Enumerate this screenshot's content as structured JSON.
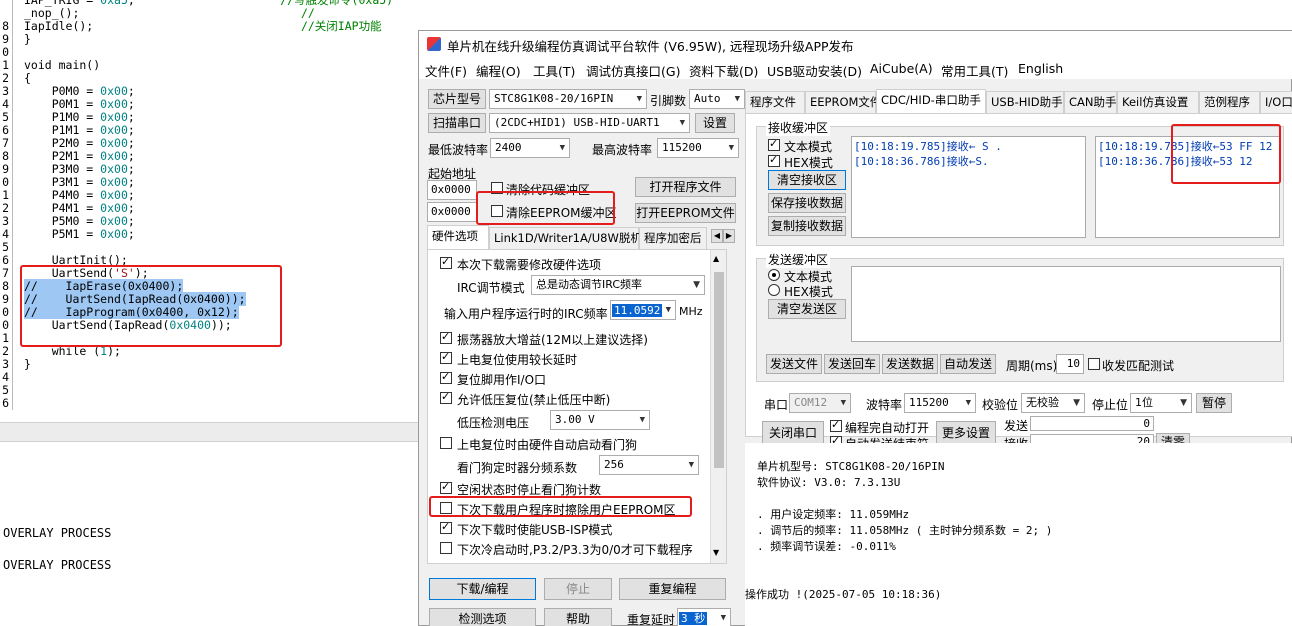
{
  "editor": {
    "lines": [
      {
        "n": "",
        "html": "IAP_TRIG = <span class='num'>0xa5</span>;                     <span class='cmt'>//写触发命令(0xa5)</span>"
      },
      {
        "n": "",
        "html": "_nop_();                                <span class='cmt'>//</span>"
      },
      {
        "n": "8",
        "html": "IapIdle();                              <span class='cmt'>//关闭IAP功能</span>"
      },
      {
        "n": "9",
        "html": "}"
      },
      {
        "n": "0",
        "html": ""
      },
      {
        "n": "1",
        "html": "void main()"
      },
      {
        "n": "2",
        "html": "{"
      },
      {
        "n": "3",
        "html": "    P0M0 = <span class='num'>0x00</span>;"
      },
      {
        "n": "4",
        "html": "    P0M1 = <span class='num'>0x00</span>;"
      },
      {
        "n": "5",
        "html": "    P1M0 = <span class='num'>0x00</span>;"
      },
      {
        "n": "6",
        "html": "    P1M1 = <span class='num'>0x00</span>;"
      },
      {
        "n": "7",
        "html": "    P2M0 = <span class='num'>0x00</span>;"
      },
      {
        "n": "8",
        "html": "    P2M1 = <span class='num'>0x00</span>;"
      },
      {
        "n": "9",
        "html": "    P3M0 = <span class='num'>0x00</span>;"
      },
      {
        "n": "0",
        "html": "    P3M1 = <span class='num'>0x00</span>;"
      },
      {
        "n": "1",
        "html": "    P4M0 = <span class='num'>0x00</span>;"
      },
      {
        "n": "2",
        "html": "    P4M1 = <span class='num'>0x00</span>;"
      },
      {
        "n": "3",
        "html": "    P5M0 = <span class='num'>0x00</span>;"
      },
      {
        "n": "4",
        "html": "    P5M1 = <span class='num'>0x00</span>;"
      },
      {
        "n": "5",
        "html": ""
      },
      {
        "n": "6",
        "html": "    UartInit();"
      },
      {
        "n": "7",
        "html": "    UartSend(<span class='str'>'S'</span>);"
      },
      {
        "n": "8",
        "html": "<span class='sel'>//    IapErase(0x0400);</span>"
      },
      {
        "n": "9",
        "html": "<span class='sel'>//    UartSend(IapRead(0x0400));</span>"
      },
      {
        "n": "0",
        "html": "<span class='sel'>//    IapProgram(0x0400, 0x12);</span>"
      },
      {
        "n": "0",
        "html": "    UartSend(IapRead(<span class='num'>0x0400</span>));"
      },
      {
        "n": "1",
        "html": ""
      },
      {
        "n": "2",
        "html": "    while (<span class='num'>1</span>);"
      },
      {
        "n": "3",
        "html": "}"
      },
      {
        "n": "4",
        "html": ""
      },
      {
        "n": "5",
        "html": ""
      },
      {
        "n": "6",
        "html": ""
      }
    ]
  },
  "output": {
    "lines": [
      "OVERLAY PROCESS",
      "OVERLAY PROCESS"
    ]
  },
  "window": {
    "title": "单片机在线升级编程仿真调试平台软件 (V6.95W), 远程现场升级APP发布",
    "menu": [
      "文件(F)",
      "编程(O)",
      "工具(T)",
      "调试仿真接口(G)",
      "资料下载(D)",
      "USB驱动安装(D)",
      "AiCube(A)",
      "常用工具(T)",
      "English"
    ]
  },
  "left": {
    "chip_btn": "芯片型号",
    "chip_value": "STC8G1K08-20/16PIN",
    "pin_label": "引脚数",
    "pin_value": "Auto",
    "scan_btn": "扫描串口",
    "port_value": "(2CDC+HID1) USB-HID-UART1",
    "settings_btn": "设置",
    "min_baud_label": "最低波特率",
    "min_baud_value": "2400",
    "max_baud_label": "最高波特率",
    "max_baud_value": "115200",
    "start_addr_label": "起始地址",
    "addr1": "0x0000",
    "addr2": "0x0000",
    "clear_code": "清除代码缓冲区",
    "clear_eeprom": "清除EEPROM缓冲区",
    "open_prog_btn": "打开程序文件",
    "open_eeprom_btn": "打开EEPROM文件",
    "tabs": [
      "硬件选项",
      "Link1D/Writer1A/U8W脱机",
      "程序加密后"
    ],
    "options": {
      "opt1": "本次下载需要修改硬件选项",
      "irc_mode_label": "IRC调节模式",
      "irc_mode_value": "总是动态调节IRC频率",
      "irc_freq_label": "输入用户程序运行时的IRC频率",
      "irc_freq_value": "11.0592",
      "irc_unit": "MHz",
      "opt2": "振荡器放大增益(12M以上建议选择)",
      "opt3": "上电复位使用较长延时",
      "opt4": "复位脚用作I/O口",
      "opt5": "允许低压复位(禁止低压中断)",
      "lvd_label": "低压检测电压",
      "lvd_value": "3.00 V",
      "opt6": "上电复位时由硬件自动启动看门狗",
      "wdt_label": "看门狗定时器分频系数",
      "wdt_value": "256",
      "opt7": "空闲状态时停止看门狗计数",
      "opt8": "下次下载用户程序时擦除用户EEPROM区",
      "opt9": "下次下载时使能USB-ISP模式",
      "opt10": "下次冷启动时,P3.2/P3.3为0/0才可下载程序"
    },
    "download_btn": "下载/编程",
    "stop_btn": "停止",
    "reprog_btn": "重复编程",
    "detect_btn": "检测选项",
    "help_btn": "帮助",
    "repeat_delay_label": "重复延时",
    "repeat_delay_value": "3 秒"
  },
  "right": {
    "tabs": [
      "程序文件",
      "EEPROM文件",
      "CDC/HID-串口助手",
      "USB-HID助手",
      "CAN助手",
      "Keil仿真设置",
      "范例程序",
      "I/O口"
    ],
    "recv_group": "接收缓冲区",
    "text_mode": "文本模式",
    "hex_mode": "HEX模式",
    "clear_recv_btn": "清空接收区",
    "save_recv_btn": "保存接收数据",
    "copy_recv_btn": "复制接收数据",
    "recv_text": [
      "[10:18:19.785]接收←  S  .",
      "[10:18:36.786]接收←S."
    ],
    "recv_hex": [
      "[10:18:19.785]接收←53 FF 12",
      "[10:18:36.786]接收←53 12"
    ],
    "send_group": "发送缓冲区",
    "send_text_mode": "文本模式",
    "send_hex_mode": "HEX模式",
    "clear_send_btn": "清空发送区",
    "send_file_btn": "发送文件",
    "send_return_btn": "发送回车",
    "send_data_btn": "发送数据",
    "auto_send_btn": "自动发送",
    "period_label": "周期(ms)",
    "period_value": "10",
    "match_label": "收发匹配测试",
    "port_label": "串口",
    "port_value": "COM12",
    "baud_label": "波特率",
    "baud_value": "115200",
    "parity_label": "校验位",
    "parity_value": "无校验",
    "stop_label": "停止位",
    "stop_value": "1位",
    "pause_btn": "暂停",
    "close_port_btn": "关闭串口",
    "auto_open": "编程完自动打开",
    "auto_send_end": "自动发送结束符",
    "more_btn": "更多设置",
    "send_count_label": "发送",
    "send_count": "0",
    "recv_count_label": "接收",
    "recv_count": "20",
    "clear_btn": "清零",
    "log": [
      "单片机型号: STC8G1K08-20/16PIN",
      "软件协议: V3.0: 7.3.13U",
      "",
      ". 用户设定频率: 11.059MHz",
      ". 调节后的频率: 11.058MHz ( 主时钟分频系数 = 2; )",
      ". 频率调节误差: -0.011%",
      "",
      "",
      "操作成功 !(2025-07-05 10:18:36)"
    ]
  }
}
